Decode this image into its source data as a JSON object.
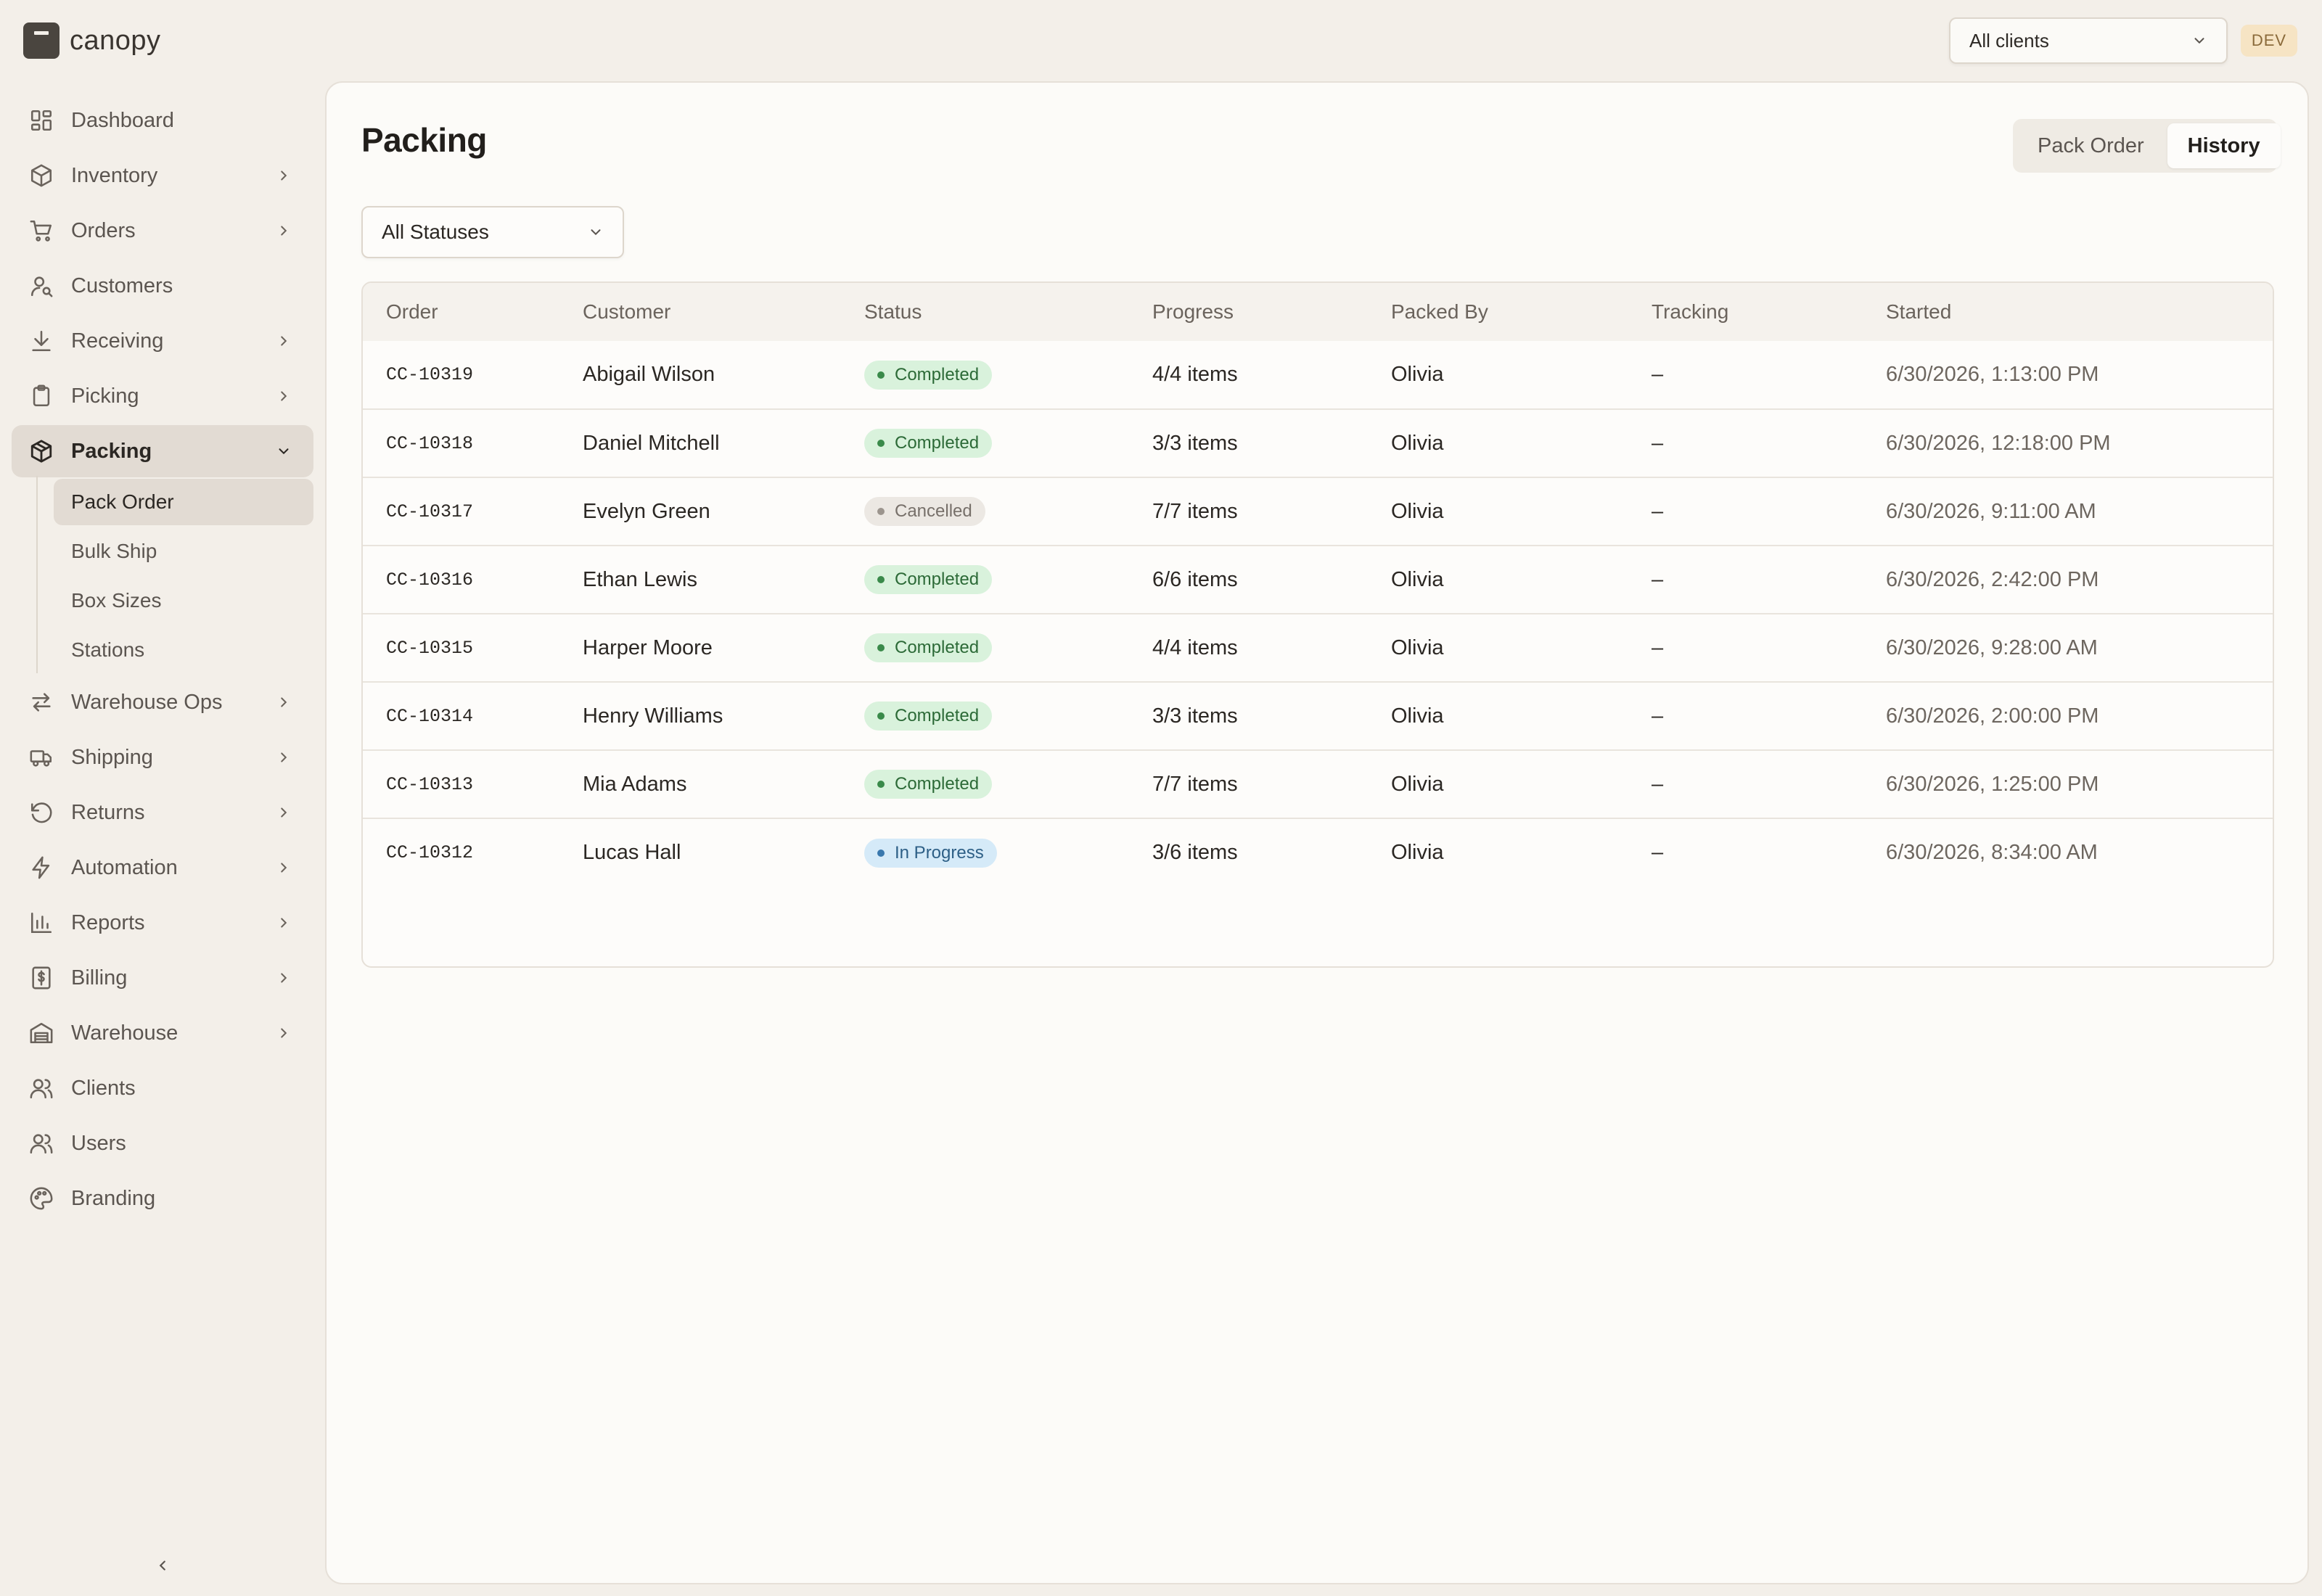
{
  "app": {
    "name": "canopy",
    "env_badge": "DEV"
  },
  "header": {
    "client_select": "All clients"
  },
  "sidebar": {
    "items": [
      {
        "label": "Dashboard",
        "icon": "dashboard-icon"
      },
      {
        "label": "Inventory",
        "icon": "box-icon"
      },
      {
        "label": "Orders",
        "icon": "cart-icon"
      },
      {
        "label": "Customers",
        "icon": "user-search-icon"
      },
      {
        "label": "Receiving",
        "icon": "download-icon"
      },
      {
        "label": "Picking",
        "icon": "clipboard-icon"
      },
      {
        "label": "Packing",
        "icon": "package-icon"
      },
      {
        "label": "Warehouse Ops",
        "icon": "arrows-swap-icon"
      },
      {
        "label": "Shipping",
        "icon": "truck-icon"
      },
      {
        "label": "Returns",
        "icon": "rotate-ccw-icon"
      },
      {
        "label": "Automation",
        "icon": "lightning-icon"
      },
      {
        "label": "Reports",
        "icon": "bar-chart-icon"
      },
      {
        "label": "Billing",
        "icon": "dollar-receipt-icon"
      },
      {
        "label": "Warehouse",
        "icon": "warehouse-icon"
      },
      {
        "label": "Clients",
        "icon": "users-icon"
      },
      {
        "label": "Users",
        "icon": "users-icon"
      },
      {
        "label": "Branding",
        "icon": "palette-icon"
      }
    ],
    "packing_sub": [
      "Pack Order",
      "Bulk Ship",
      "Box Sizes",
      "Stations"
    ]
  },
  "main": {
    "title": "Packing",
    "tabs": [
      "Pack Order",
      "History"
    ],
    "status_filter": "All Statuses",
    "columns": [
      "Order",
      "Customer",
      "Status",
      "Progress",
      "Packed By",
      "Tracking",
      "Started"
    ],
    "rows": [
      {
        "order": "CC-10319",
        "customer": "Abigail Wilson",
        "status": "Completed",
        "progress": "4/4 items",
        "packed_by": "Olivia",
        "tracking": "–",
        "started": "6/30/2026, 1:13:00 PM"
      },
      {
        "order": "CC-10318",
        "customer": "Daniel Mitchell",
        "status": "Completed",
        "progress": "3/3 items",
        "packed_by": "Olivia",
        "tracking": "–",
        "started": "6/30/2026, 12:18:00 PM"
      },
      {
        "order": "CC-10317",
        "customer": "Evelyn Green",
        "status": "Cancelled",
        "progress": "7/7 items",
        "packed_by": "Olivia",
        "tracking": "–",
        "started": "6/30/2026, 9:11:00 AM"
      },
      {
        "order": "CC-10316",
        "customer": "Ethan Lewis",
        "status": "Completed",
        "progress": "6/6 items",
        "packed_by": "Olivia",
        "tracking": "–",
        "started": "6/30/2026, 2:42:00 PM"
      },
      {
        "order": "CC-10315",
        "customer": "Harper Moore",
        "status": "Completed",
        "progress": "4/4 items",
        "packed_by": "Olivia",
        "tracking": "–",
        "started": "6/30/2026, 9:28:00 AM"
      },
      {
        "order": "CC-10314",
        "customer": "Henry Williams",
        "status": "Completed",
        "progress": "3/3 items",
        "packed_by": "Olivia",
        "tracking": "–",
        "started": "6/30/2026, 2:00:00 PM"
      },
      {
        "order": "CC-10313",
        "customer": "Mia Adams",
        "status": "Completed",
        "progress": "7/7 items",
        "packed_by": "Olivia",
        "tracking": "–",
        "started": "6/30/2026, 1:25:00 PM"
      },
      {
        "order": "CC-10312",
        "customer": "Lucas Hall",
        "status": "In Progress",
        "progress": "3/6 items",
        "packed_by": "Olivia",
        "tracking": "–",
        "started": "6/30/2026, 8:34:00 AM"
      }
    ]
  },
  "colors": {
    "background": "#f3efe9",
    "panel": "#fcfbf8",
    "active_nav": "#e2dbd3",
    "completed": "#d9f2dc",
    "cancelled": "#ece8e3",
    "in_progress": "#d5eaf8"
  }
}
